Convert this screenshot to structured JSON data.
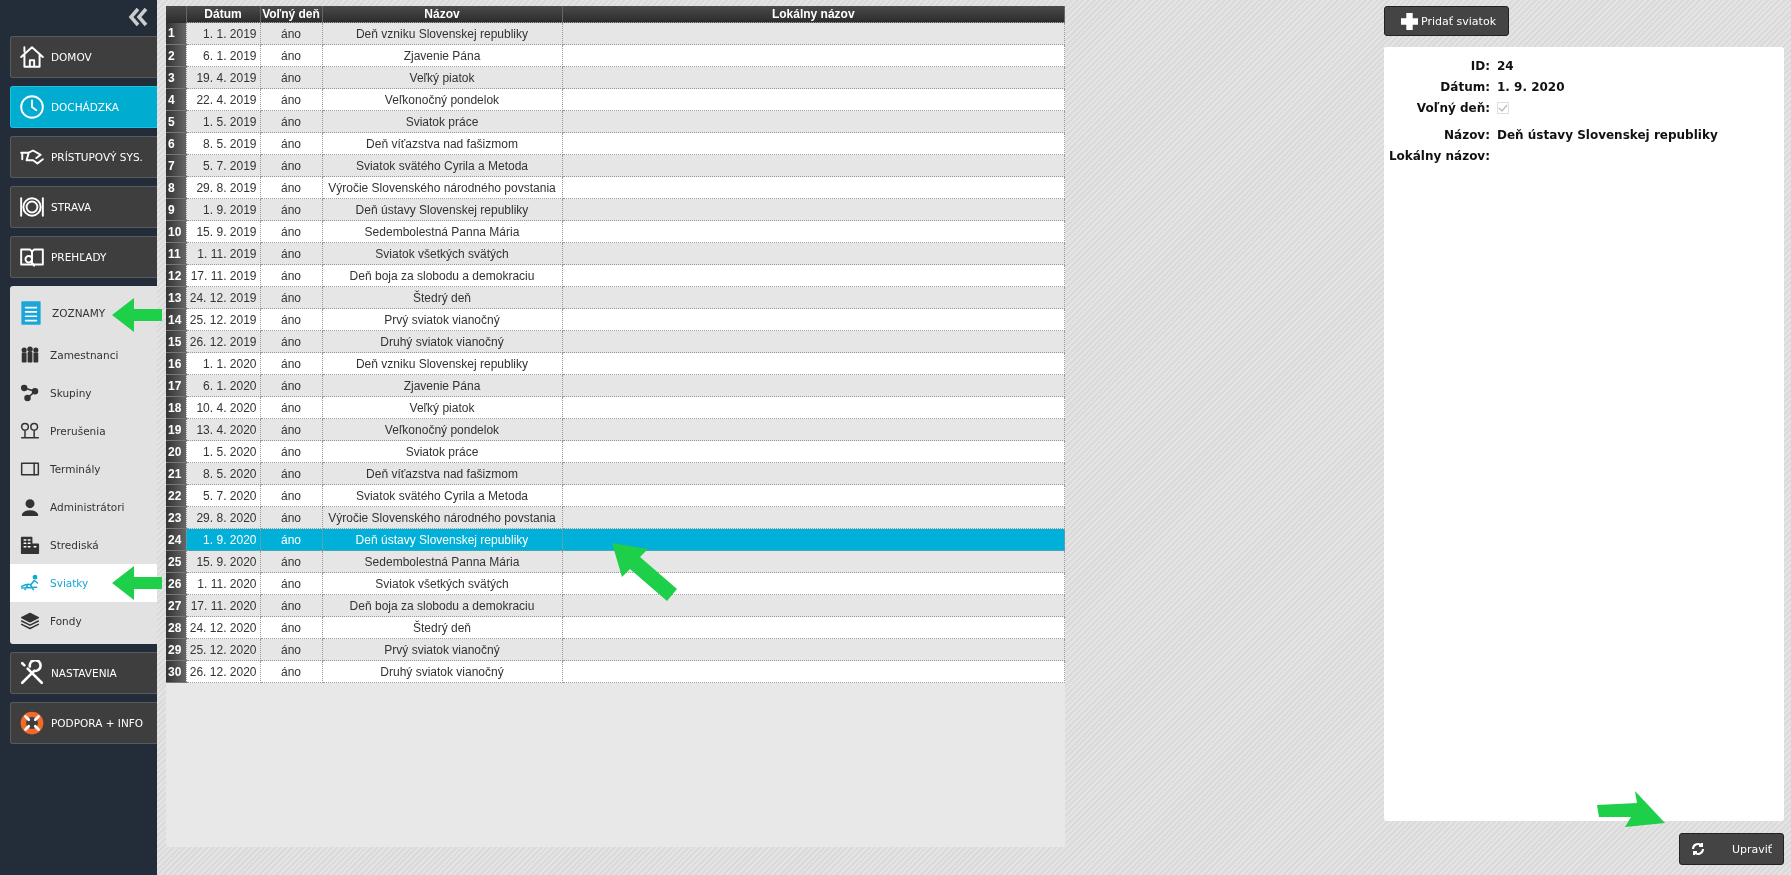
{
  "sidebar": {
    "menu": [
      {
        "kind": "main",
        "label": "DOMOV",
        "selected": false
      },
      {
        "kind": "main",
        "label": "DOCHÁDZKA",
        "selected": true
      },
      {
        "kind": "main",
        "label": "PRÍSTUPOVÝ SYS.",
        "selected": false
      },
      {
        "kind": "main",
        "label": "STRAVA",
        "selected": false
      },
      {
        "kind": "main",
        "label": "PREHĽADY",
        "selected": false
      },
      {
        "kind": "group",
        "label": "ZOZNAMY",
        "expanded": true,
        "children": [
          {
            "label": "Zamestnanci",
            "selected": false
          },
          {
            "label": "Skupiny",
            "selected": false
          },
          {
            "label": "Prerušenia",
            "selected": false
          },
          {
            "label": "Terminály",
            "selected": false
          },
          {
            "label": "Administrátori",
            "selected": false
          },
          {
            "label": "Strediská",
            "selected": false
          },
          {
            "label": "Sviatky",
            "selected": true
          },
          {
            "label": "Fondy",
            "selected": false
          }
        ]
      },
      {
        "kind": "main",
        "label": "NASTAVENIA",
        "selected": false
      },
      {
        "kind": "main",
        "label": "PODPORA + INFO",
        "selected": false
      }
    ]
  },
  "table": {
    "columns": [
      "Dátum",
      "Voľný deň",
      "Názov",
      "Lokálny názov"
    ],
    "rows": [
      {
        "number": "1",
        "date": "1. 1. 2019",
        "free": "áno",
        "name": "Deň vzniku Slovenskej republiky",
        "selected": false
      },
      {
        "number": "2",
        "date": "6. 1. 2019",
        "free": "áno",
        "name": "Zjavenie Pána",
        "selected": false
      },
      {
        "number": "3",
        "date": "19. 4. 2019",
        "free": "áno",
        "name": "Veľký piatok",
        "selected": false
      },
      {
        "number": "4",
        "date": "22. 4. 2019",
        "free": "áno",
        "name": "Veľkonočný pondelok",
        "selected": false
      },
      {
        "number": "5",
        "date": "1. 5. 2019",
        "free": "áno",
        "name": "Sviatok práce",
        "selected": false
      },
      {
        "number": "6",
        "date": "8. 5. 2019",
        "free": "áno",
        "name": "Deň víťazstva nad fašizmom",
        "selected": false
      },
      {
        "number": "7",
        "date": "5. 7. 2019",
        "free": "áno",
        "name": "Sviatok svätého Cyrila a Metoda",
        "selected": false
      },
      {
        "number": "8",
        "date": "29. 8. 2019",
        "free": "áno",
        "name": "Výročie Slovenského národného povstania",
        "selected": false
      },
      {
        "number": "9",
        "date": "1. 9. 2019",
        "free": "áno",
        "name": "Deň ústavy Slovenskej republiky",
        "selected": false
      },
      {
        "number": "10",
        "date": "15. 9. 2019",
        "free": "áno",
        "name": "Sedembolestná Panna Mária",
        "selected": false
      },
      {
        "number": "11",
        "date": "1. 11. 2019",
        "free": "áno",
        "name": "Sviatok všetkých svätých",
        "selected": false
      },
      {
        "number": "12",
        "date": "17. 11. 2019",
        "free": "áno",
        "name": "Deň boja za slobodu a demokraciu",
        "selected": false
      },
      {
        "number": "13",
        "date": "24. 12. 2019",
        "free": "áno",
        "name": "Štedrý deň",
        "selected": false
      },
      {
        "number": "14",
        "date": "25. 12. 2019",
        "free": "áno",
        "name": "Prvý sviatok vianočný",
        "selected": false
      },
      {
        "number": "15",
        "date": "26. 12. 2019",
        "free": "áno",
        "name": "Druhý sviatok vianočný",
        "selected": false
      },
      {
        "number": "16",
        "date": "1. 1. 2020",
        "free": "áno",
        "name": "Deň vzniku Slovenskej republiky",
        "selected": false
      },
      {
        "number": "17",
        "date": "6. 1. 2020",
        "free": "áno",
        "name": "Zjavenie Pána",
        "selected": false
      },
      {
        "number": "18",
        "date": "10. 4. 2020",
        "free": "áno",
        "name": "Veľký piatok",
        "selected": false
      },
      {
        "number": "19",
        "date": "13. 4. 2020",
        "free": "áno",
        "name": "Veľkonočný pondelok",
        "selected": false
      },
      {
        "number": "20",
        "date": "1. 5. 2020",
        "free": "áno",
        "name": "Sviatok práce",
        "selected": false
      },
      {
        "number": "21",
        "date": "8. 5. 2020",
        "free": "áno",
        "name": "Deň víťazstva nad fašizmom",
        "selected": false
      },
      {
        "number": "22",
        "date": "5. 7. 2020",
        "free": "áno",
        "name": "Sviatok svätého Cyrila a Metoda",
        "selected": false
      },
      {
        "number": "23",
        "date": "29. 8. 2020",
        "free": "áno",
        "name": "Výročie Slovenského národného povstania",
        "selected": false
      },
      {
        "number": "24",
        "date": "1. 9. 2020",
        "free": "áno",
        "name": "Deň ústavy Slovenskej republiky",
        "selected": true
      },
      {
        "number": "25",
        "date": "15. 9. 2020",
        "free": "áno",
        "name": "Sedembolestná Panna Mária",
        "selected": false
      },
      {
        "number": "26",
        "date": "1. 11. 2020",
        "free": "áno",
        "name": "Sviatok všetkých svätých",
        "selected": false
      },
      {
        "number": "27",
        "date": "17. 11. 2020",
        "free": "áno",
        "name": "Deň boja za slobodu a demokraciu",
        "selected": false
      },
      {
        "number": "28",
        "date": "24. 12. 2020",
        "free": "áno",
        "name": "Štedrý deň",
        "selected": false
      },
      {
        "number": "29",
        "date": "25. 12. 2020",
        "free": "áno",
        "name": "Prvý sviatok vianočný",
        "selected": false
      },
      {
        "number": "30",
        "date": "26. 12. 2020",
        "free": "áno",
        "name": "Druhý sviatok vianočný",
        "selected": false
      }
    ]
  },
  "add_button": {
    "label": "Pridať sviatok"
  },
  "detail": {
    "fields": [
      {
        "kind": "text",
        "label": "ID:",
        "value": "24"
      },
      {
        "kind": "text",
        "label": "Dátum:",
        "value": "1. 9. 2020"
      },
      {
        "kind": "checkbox",
        "label": "Voľný deň:",
        "checked": true,
        "disabled": true
      },
      {
        "kind": "text",
        "label": "Názov:",
        "value": "Deň ústavy Slovenskej republiky"
      },
      {
        "kind": "text",
        "label": "Lokálny názov:"
      }
    ]
  },
  "edit_button": {
    "label": "Upraviť"
  }
}
